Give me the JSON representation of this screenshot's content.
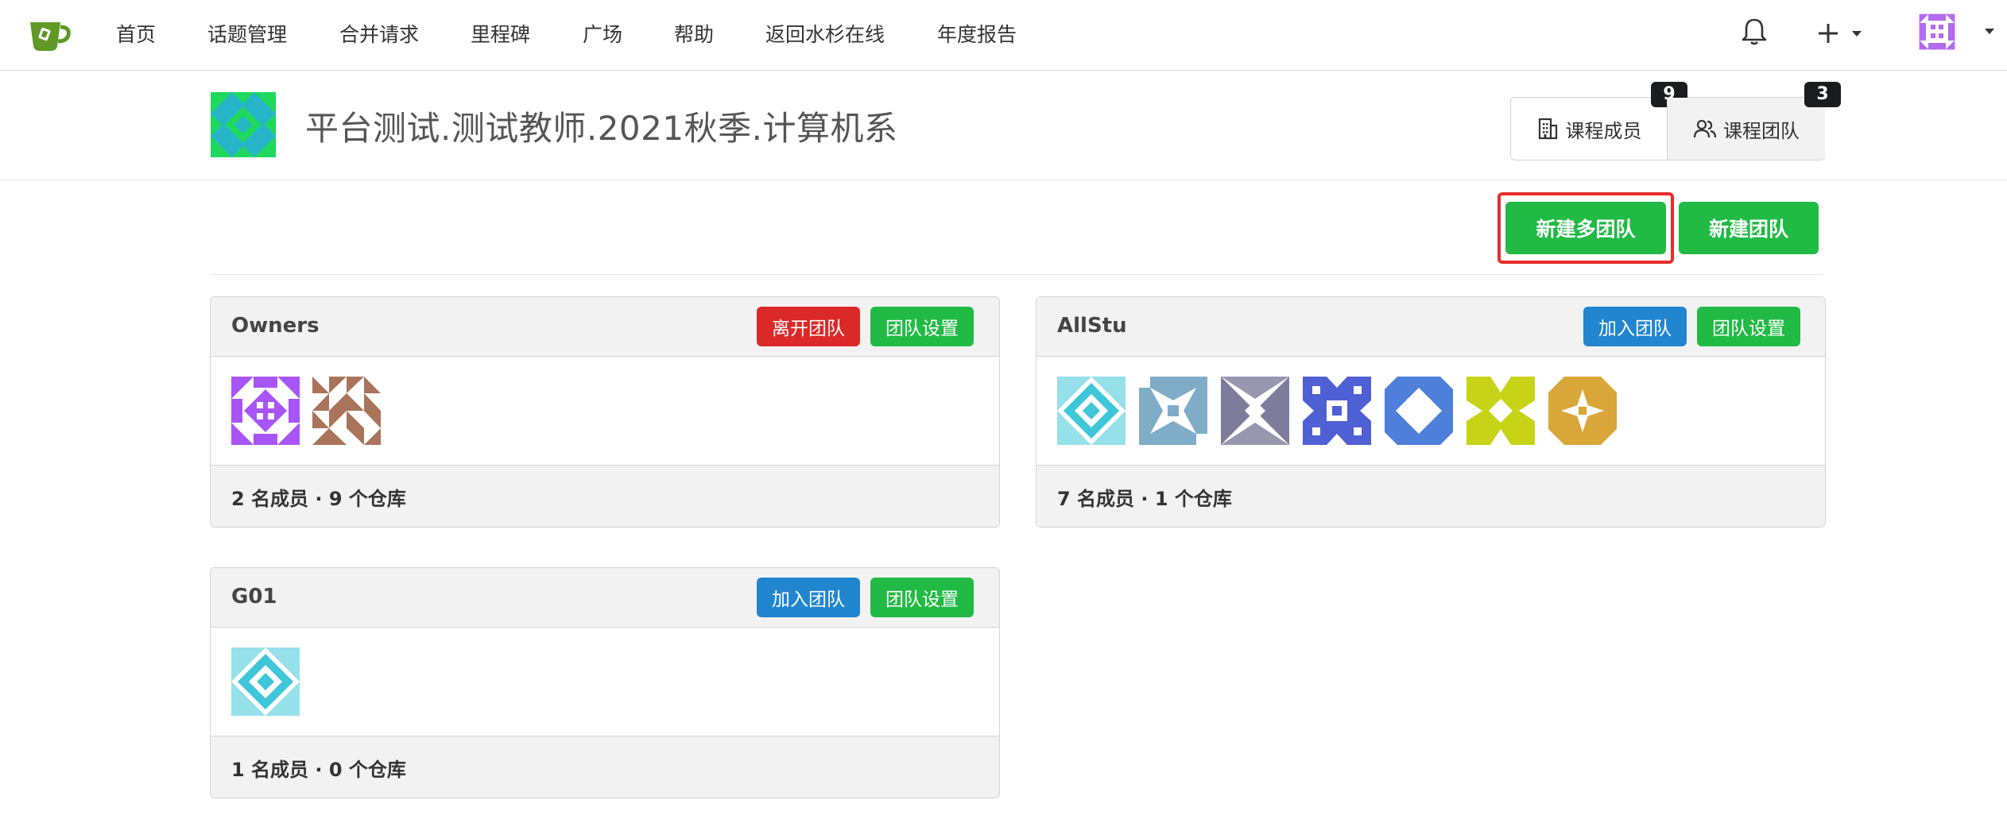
{
  "nav": {
    "items": [
      "首页",
      "话题管理",
      "合并请求",
      "里程碑",
      "广场",
      "帮助",
      "返回水杉在线",
      "年度报告"
    ],
    "icons": {
      "logo": "teacup-logo",
      "bell": "bell-icon",
      "create": "plus-icon",
      "user": "user-avatar"
    }
  },
  "org": {
    "title": "平台测试.测试教师.2021秋季.计算机系",
    "tabs": [
      {
        "label": "课程成员",
        "count": "9",
        "icon": "building-icon"
      },
      {
        "label": "课程团队",
        "count": "3",
        "icon": "people-icon"
      }
    ]
  },
  "actions": {
    "new_multi_team": "新建多团队",
    "new_team": "新建团队"
  },
  "teams": [
    {
      "name": "Owners",
      "buttons": [
        {
          "label": "离开团队",
          "style": "red"
        },
        {
          "label": "团队设置",
          "style": "green"
        }
      ],
      "members": 2,
      "stats": "2 名成员 · 9 个仓库",
      "avatar_colors": [
        "#a855f7",
        "#a9745a"
      ]
    },
    {
      "name": "AllStu",
      "buttons": [
        {
          "label": "加入团队",
          "style": "blue"
        },
        {
          "label": "团队设置",
          "style": "green"
        }
      ],
      "members": 7,
      "stats": "7 名成员 · 1 个仓库",
      "avatar_colors": [
        "#3fc6d9",
        "#7fadc7",
        "#7d7d9b",
        "#4f5fd4",
        "#4e7fdb",
        "#c7d317",
        "#d9a63a"
      ]
    },
    {
      "name": "G01",
      "buttons": [
        {
          "label": "加入团队",
          "style": "blue"
        },
        {
          "label": "团队设置",
          "style": "green"
        }
      ],
      "members": 1,
      "stats": "1 名成员 · 0 个仓库",
      "avatar_colors": [
        "#3fc6d9"
      ]
    }
  ],
  "colors": {
    "green": "#21ba45",
    "red": "#db2828",
    "blue": "#2185d0",
    "highlight": "#e52d2d",
    "badge": "#1b1c1d"
  }
}
